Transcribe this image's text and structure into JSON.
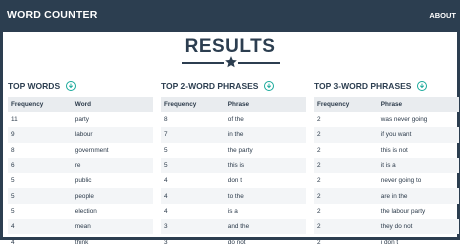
{
  "header": {
    "brand": "WORD COUNTER",
    "nav_about": "ABOUT"
  },
  "page": {
    "title": "RESULTS"
  },
  "colors": {
    "navbar": "#2c3e50",
    "accent": "#18a99a",
    "header_row": "#e9ecef",
    "stripe": "#f3f5f7"
  },
  "icons": [
    "star-icon",
    "download-icon"
  ],
  "sections": [
    {
      "title": "TOP WORDS",
      "columns": [
        "Frequency",
        "Word"
      ],
      "rows": [
        [
          "11",
          "party"
        ],
        [
          "9",
          "labour"
        ],
        [
          "8",
          "government"
        ],
        [
          "6",
          "re"
        ],
        [
          "5",
          "public"
        ],
        [
          "5",
          "people"
        ],
        [
          "5",
          "election"
        ],
        [
          "4",
          "mean"
        ],
        [
          "4",
          "think"
        ]
      ]
    },
    {
      "title": "TOP 2-WORD PHRASES",
      "columns": [
        "Frequency",
        "Phrase"
      ],
      "rows": [
        [
          "8",
          "of the"
        ],
        [
          "7",
          "in the"
        ],
        [
          "5",
          "the party"
        ],
        [
          "5",
          "this is"
        ],
        [
          "4",
          "don t"
        ],
        [
          "4",
          "to the"
        ],
        [
          "4",
          "is a"
        ],
        [
          "3",
          "and the"
        ],
        [
          "3",
          "do not"
        ]
      ]
    },
    {
      "title": "TOP 3-WORD PHRASES",
      "columns": [
        "Frequency",
        "Phrase"
      ],
      "rows": [
        [
          "2",
          "was never going"
        ],
        [
          "2",
          "if you want"
        ],
        [
          "2",
          "this is not"
        ],
        [
          "2",
          "it is a"
        ],
        [
          "2",
          "never going to"
        ],
        [
          "2",
          "are in the"
        ],
        [
          "2",
          "the labour party"
        ],
        [
          "2",
          "they do not"
        ],
        [
          "2",
          "i don t"
        ]
      ]
    }
  ]
}
